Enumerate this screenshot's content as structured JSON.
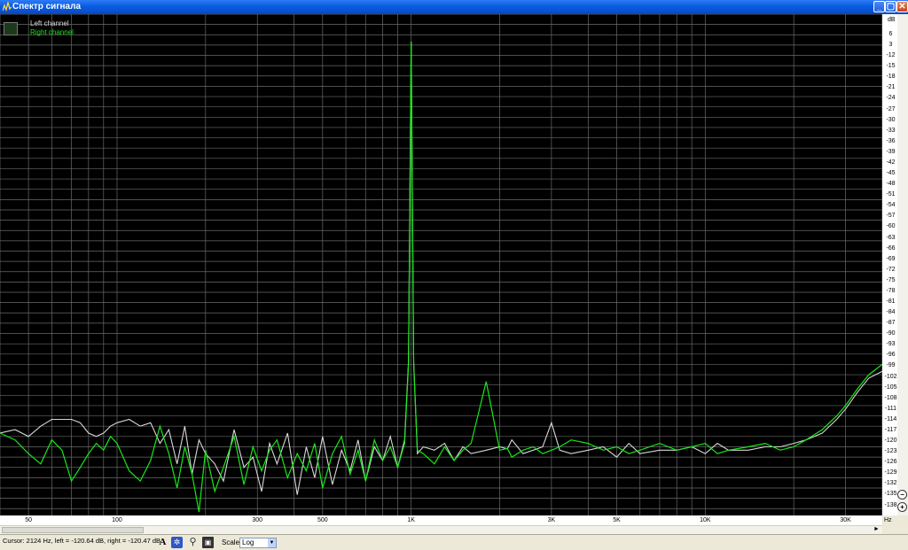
{
  "window": {
    "title": "Спектр сигнала"
  },
  "legend": {
    "left": "Left channel",
    "right": "Right channel",
    "left_color": "#d8d8d8",
    "right_color": "#17e817"
  },
  "y_axis": {
    "unit": "dB",
    "ticks": [
      "6",
      "3",
      "-12",
      "-15",
      "-18",
      "-21",
      "-24",
      "-27",
      "-30",
      "-33",
      "-36",
      "-39",
      "-42",
      "-45",
      "-48",
      "-51",
      "-54",
      "-57",
      "-60",
      "-63",
      "-66",
      "-69",
      "-72",
      "-75",
      "-78",
      "-81",
      "-84",
      "-87",
      "-90",
      "-93",
      "-96",
      "-99",
      "-102",
      "-105",
      "-108",
      "-111",
      "-114",
      "-117",
      "-120",
      "-123",
      "-126",
      "-129",
      "-132",
      "-135",
      "-138"
    ]
  },
  "x_axis": {
    "unit": "Hz",
    "ticks": [
      "50",
      "100",
      "300",
      "500",
      "1K",
      "3K",
      "5K",
      "10K",
      "30K"
    ]
  },
  "status": {
    "cursor": "Cursor:  2124 Hz,  left = -120.64 dB,  right = -120.47 dB"
  },
  "toolbar": {
    "scale_label": "Scale",
    "scale_value": "Log"
  },
  "chart_data": {
    "type": "line",
    "x_scale": "log",
    "xlim": [
      40,
      40000
    ],
    "ylim": [
      -140,
      6
    ],
    "grid": true,
    "legend_position": "top-left",
    "series": [
      {
        "name": "Left channel",
        "color": "#d8d8d8",
        "x": [
          40,
          45,
          50,
          55,
          60,
          65,
          70,
          75,
          80,
          85,
          90,
          95,
          100,
          110,
          120,
          130,
          140,
          150,
          160,
          170,
          180,
          190,
          200,
          215,
          230,
          250,
          270,
          290,
          310,
          330,
          350,
          380,
          410,
          440,
          470,
          500,
          540,
          580,
          620,
          660,
          700,
          750,
          800,
          850,
          900,
          950,
          980,
          1000,
          1020,
          1050,
          1100,
          1200,
          1300,
          1400,
          1500,
          1600,
          1800,
          2000,
          2124,
          2200,
          2400,
          2600,
          2800,
          3000,
          3200,
          3500,
          4000,
          4500,
          5000,
          5500,
          6000,
          7000,
          8000,
          9000,
          10000,
          11000,
          12000,
          14000,
          16000,
          18000,
          20000,
          22000,
          25000,
          28000,
          30000,
          33000,
          36000,
          40000
        ],
        "y": [
          -116,
          -115,
          -117,
          -114,
          -112,
          -112,
          -112,
          -113,
          -116,
          -117,
          -116,
          -114,
          -113,
          -112,
          -114,
          -113,
          -119,
          -115,
          -125,
          -114,
          -128,
          -118,
          -122,
          -125,
          -130,
          -115,
          -126,
          -123,
          -133,
          -119,
          -125,
          -116,
          -134,
          -120,
          -129,
          -117,
          -131,
          -121,
          -127,
          -118,
          -130,
          -120,
          -124,
          -117,
          -126,
          -118,
          -95,
          -2,
          -95,
          -122,
          -120,
          -121,
          -119,
          -124,
          -120,
          -122,
          -121,
          -120,
          -120.64,
          -118,
          -122,
          -121,
          -120,
          -113,
          -121,
          -122,
          -121,
          -120,
          -123,
          -119,
          -122,
          -121,
          -121,
          -120,
          -122,
          -119,
          -121,
          -121,
          -120,
          -120,
          -119,
          -118,
          -116,
          -112,
          -109,
          -104,
          -100,
          -98
        ]
      },
      {
        "name": "Right channel",
        "color": "#17e817",
        "x": [
          40,
          45,
          50,
          55,
          60,
          65,
          70,
          75,
          80,
          85,
          90,
          95,
          100,
          110,
          120,
          130,
          140,
          150,
          160,
          170,
          180,
          190,
          200,
          215,
          230,
          250,
          270,
          290,
          310,
          330,
          350,
          380,
          410,
          440,
          470,
          500,
          540,
          580,
          620,
          660,
          700,
          750,
          800,
          850,
          900,
          950,
          980,
          1000,
          1020,
          1050,
          1100,
          1200,
          1300,
          1400,
          1500,
          1600,
          1800,
          2000,
          2124,
          2200,
          2400,
          2600,
          2800,
          3000,
          3200,
          3500,
          4000,
          4500,
          5000,
          5500,
          6000,
          7000,
          8000,
          9000,
          10000,
          11000,
          12000,
          14000,
          16000,
          18000,
          20000,
          22000,
          25000,
          28000,
          30000,
          33000,
          36000,
          40000
        ],
        "y": [
          -116,
          -118,
          -122,
          -125,
          -118,
          -121,
          -130,
          -126,
          -122,
          -119,
          -121,
          -117,
          -119,
          -127,
          -130,
          -124,
          -114,
          -122,
          -132,
          -120,
          -128,
          -139,
          -121,
          -133,
          -126,
          -117,
          -131,
          -120,
          -127,
          -121,
          -118,
          -129,
          -122,
          -127,
          -119,
          -132,
          -122,
          -117,
          -128,
          -121,
          -130,
          -118,
          -124,
          -120,
          -126,
          -119,
          -96,
          -2,
          -96,
          -121,
          -122,
          -125,
          -120,
          -124,
          -121,
          -119,
          -101,
          -121,
          -120.47,
          -123,
          -121,
          -120,
          -122,
          -121,
          -120,
          -118,
          -119,
          -121,
          -120,
          -122,
          -121,
          -119,
          -121,
          -120,
          -119,
          -122,
          -121,
          -120,
          -119,
          -121,
          -120,
          -118,
          -115,
          -111,
          -108,
          -103,
          -99,
          -96
        ]
      }
    ]
  }
}
